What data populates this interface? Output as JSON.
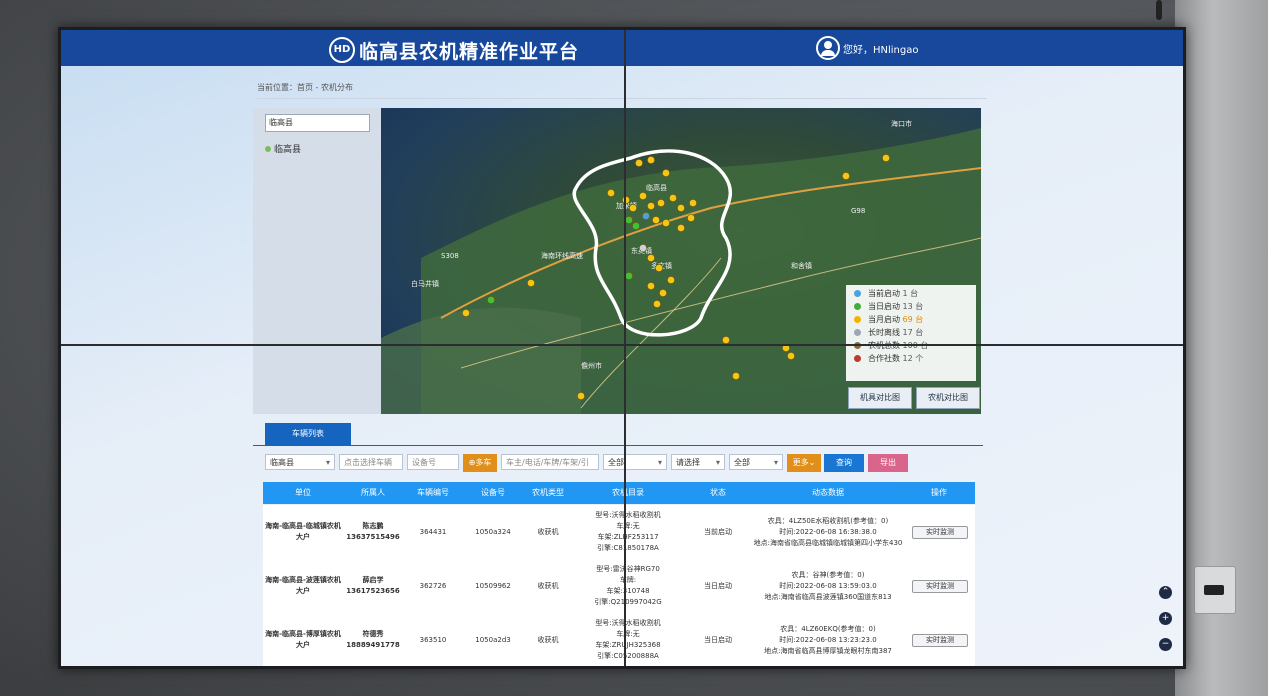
{
  "header": {
    "logo": "HD",
    "title": "临高县农机精准作业平台",
    "greeting": "您好，HNlingao"
  },
  "breadcrumb": "当前位置：首页 - 农机分布",
  "tree": {
    "search_value": "临高县",
    "node": "临高县"
  },
  "map": {
    "labels": [
      "海口市",
      "临高县",
      "加来镇",
      "白马井镇",
      "儋州市",
      "海南环线高速",
      "东英镇",
      "多文镇",
      "和舍镇",
      "G98",
      "S308"
    ]
  },
  "legend": [
    {
      "label": "当前启动",
      "count": "1 台",
      "color": "#4aa3df"
    },
    {
      "label": "当日启动",
      "count": "13 台",
      "color": "#3fae3a"
    },
    {
      "label": "当月启动",
      "count": "69 台",
      "color": "#f0b400"
    },
    {
      "label": "长时离线",
      "count": "17 台",
      "color": "#9aa7b8"
    },
    {
      "label": "农机总数",
      "count": "100 台",
      "color": "#8a6b3d"
    },
    {
      "label": "合作社数",
      "count": "12 个",
      "color": "#c0392b"
    }
  ],
  "map_buttons": {
    "machine_compare": "机具对比图",
    "tractor_compare": "农机对比图"
  },
  "tab": "车辆列表",
  "filters": {
    "county": "临高县",
    "vehicle_placeholder": "点击选择车辆",
    "device_placeholder": "设备号",
    "add_vehicle": "⊕多车",
    "owner_placeholder": "车主/电话/车牌/车架/引",
    "all1": "全部",
    "choose": "请选择",
    "all2": "全部",
    "more": "更多⌄",
    "query": "查询",
    "export": "导出"
  },
  "table": {
    "headers": [
      "单位",
      "所属人",
      "车辆编号",
      "设备号",
      "农机类型",
      "农机目录",
      "状态",
      "动态数据",
      "操作"
    ],
    "rows": [
      {
        "unit": "海南-临高县-临城镇农机大户",
        "owner": "陈志鹏",
        "phone": "13637515496",
        "vehicle_no": "364431",
        "device": "1050a324",
        "type": "收获机",
        "catalog": [
          "型号:沃得水稻收割机",
          "车牌:无",
          "车架:ZLHF253117",
          "引擎:C81850178A"
        ],
        "status": "当前启动",
        "dynamic": [
          "农具：4LZ50E水稻收割机(参考值：0)",
          "时间:2022-06-08 16:38:38.0",
          "地点:海南省临高县临城镇临城镇第四小学东430"
        ],
        "action": "实时监测"
      },
      {
        "unit": "海南-临高县-波莲镇农机大户",
        "owner": "薛启学",
        "phone": "13617523656",
        "vehicle_no": "362726",
        "device": "10509962",
        "type": "收获机",
        "catalog": [
          "型号:雷沃谷神RG70",
          "车牌:",
          "车架:310748",
          "引擎:Q210997042G"
        ],
        "status": "当日启动",
        "dynamic": [
          "农具：谷神(参考值：0)",
          "时间:2022-06-08 13:59:03.0",
          "地点:海南省临高县波莲镇360国道东813"
        ],
        "action": "实时监测"
      },
      {
        "unit": "海南-临高县-博厚镇农机大户",
        "owner": "符德秀",
        "phone": "18889491778",
        "vehicle_no": "363510",
        "device": "1050a2d3",
        "type": "收获机",
        "catalog": [
          "型号:沃得水稻收割机",
          "车牌:无",
          "车架:ZRUJH325368",
          "引擎:C05200888A"
        ],
        "status": "当日启动",
        "dynamic": [
          "农具：4LZ60EKQ(参考值：0)",
          "时间:2022-06-08 13:23:23.0",
          "地点:海南省临高县博厚镇龙眼村东南387"
        ],
        "action": "实时监测"
      }
    ]
  },
  "zoom": {
    "up": "⌃",
    "plus": "+",
    "minus": "−"
  }
}
